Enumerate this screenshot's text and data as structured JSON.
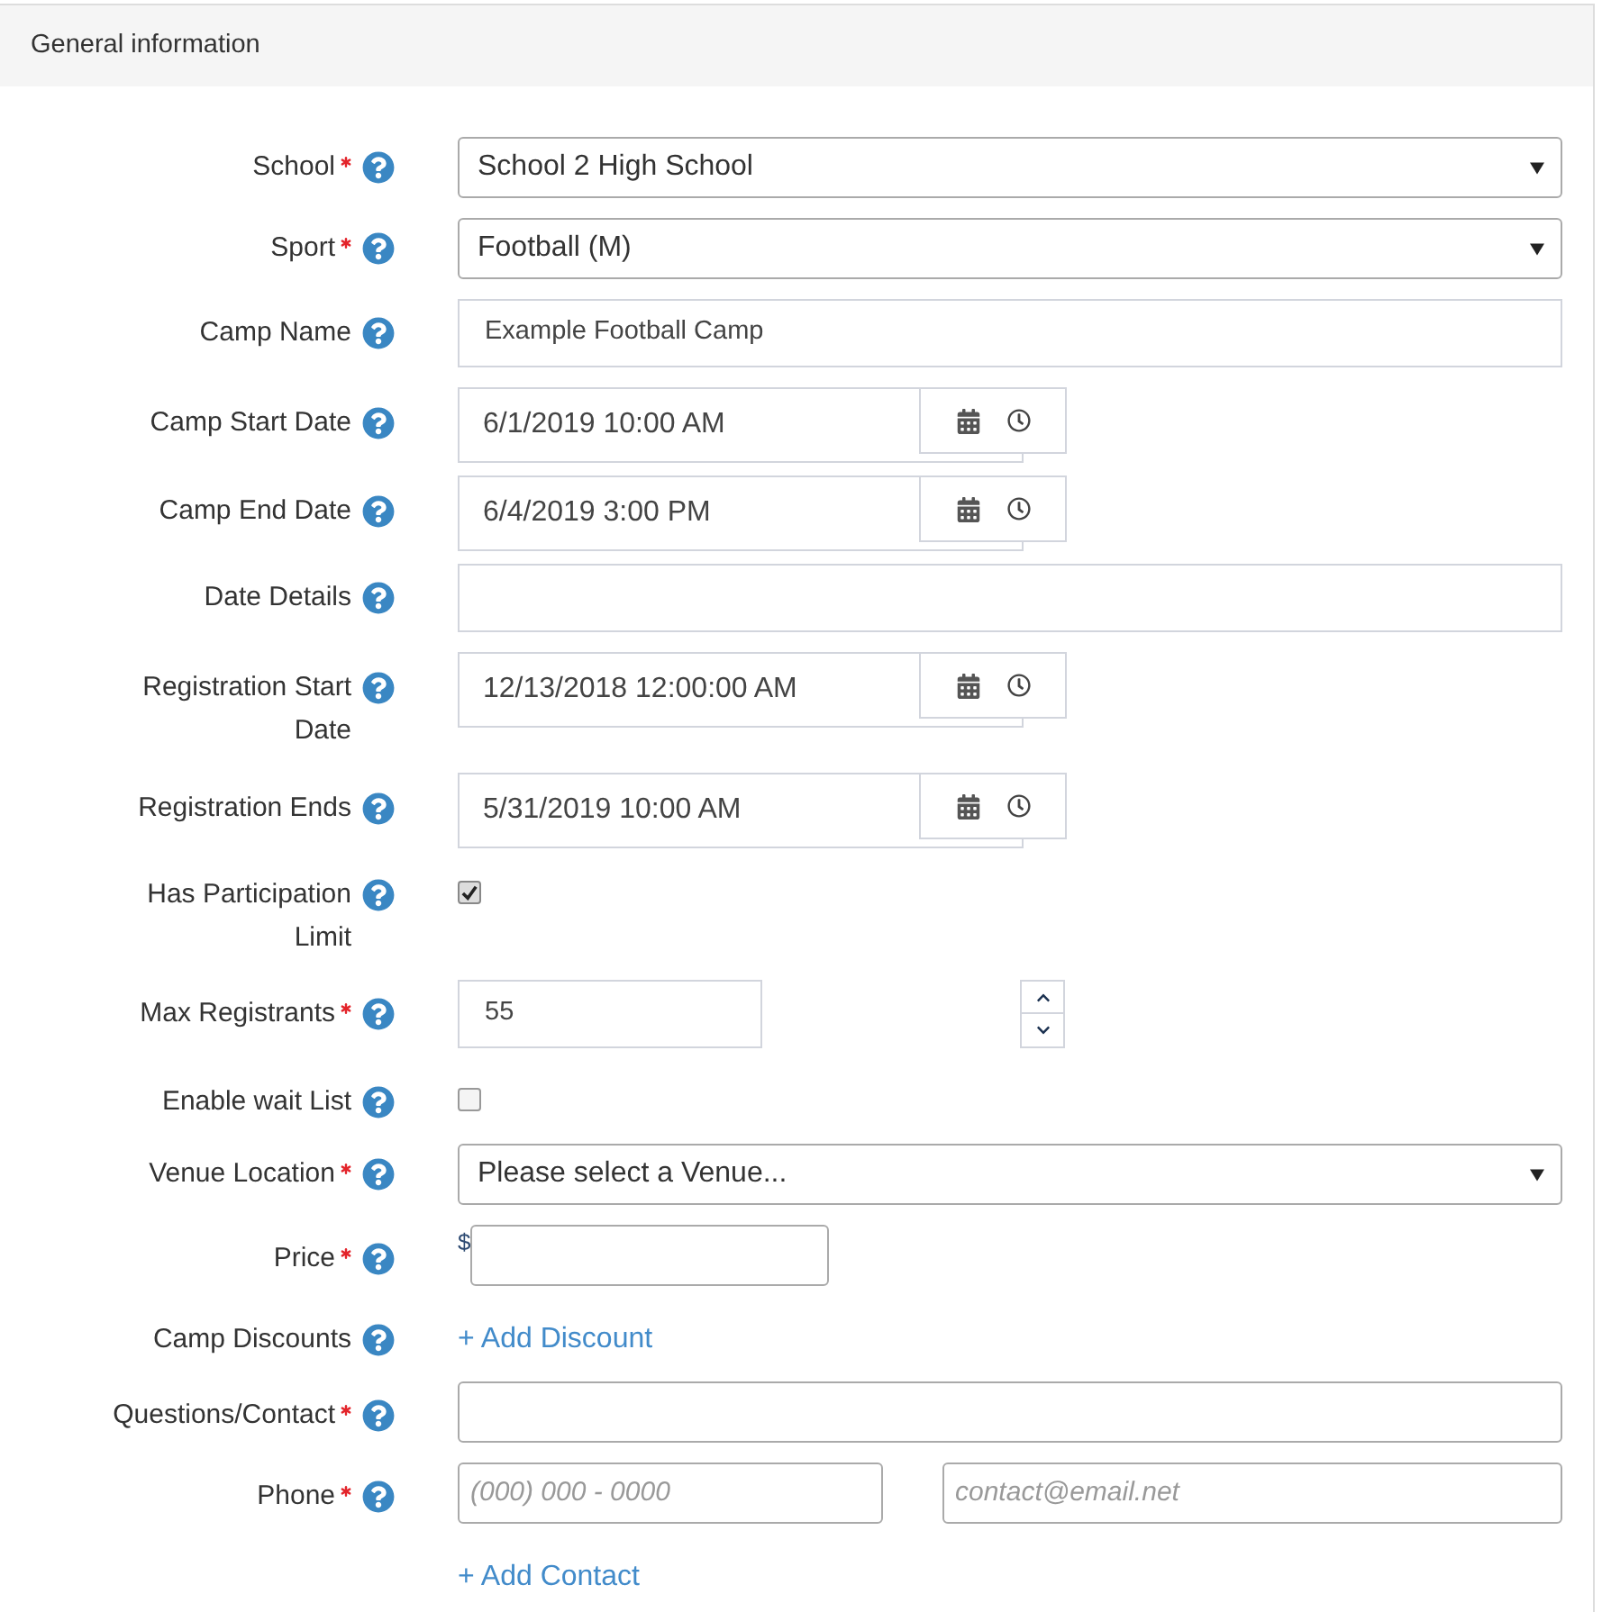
{
  "panel": {
    "title": "General information"
  },
  "fields": [
    {
      "kind": "select",
      "label": "School",
      "required": true,
      "value": "School 2 High School"
    },
    {
      "kind": "select",
      "label": "Sport",
      "required": true,
      "value": "Football (M)"
    },
    {
      "kind": "text",
      "label": "Camp Name",
      "required": false,
      "value": "Example Football Camp"
    },
    {
      "kind": "datetime",
      "label": "Camp Start Date",
      "required": false,
      "value": "6/1/2019 10:00 AM"
    },
    {
      "kind": "datetime",
      "label": "Camp End Date",
      "required": false,
      "value": "6/4/2019 3:00 PM"
    },
    {
      "kind": "text",
      "label": "Date Details",
      "required": false
    },
    {
      "kind": "datetime",
      "label": "Registration Start Date",
      "required": false,
      "value": "12/13/2018 12:00:00 AM"
    },
    {
      "kind": "datetime",
      "label": "Registration Ends",
      "required": false,
      "value": "5/31/2019 10:00 AM"
    },
    {
      "kind": "checkbox",
      "label": "Has Participation Limit",
      "required": false,
      "checked": true
    },
    {
      "kind": "number",
      "label": "Max Registrants",
      "required": true,
      "value": "55"
    },
    {
      "kind": "checkbox",
      "label": "Enable wait List",
      "required": false,
      "checked": false
    },
    {
      "kind": "select",
      "label": "Venue Location",
      "required": true,
      "value": "Please select a Venue..."
    },
    {
      "kind": "price",
      "label": "Price",
      "required": true,
      "currency": "$"
    },
    {
      "kind": "link",
      "label": "Camp Discounts",
      "required": false,
      "link": "+ Add Discount"
    },
    {
      "kind": "input",
      "label": "Questions/Contact",
      "required": true
    },
    {
      "kind": "contact",
      "label": "Phone",
      "required": true,
      "phone": {
        "placeholder": "(000) 000 - 0000"
      },
      "email": {
        "placeholder": "contact@email.net"
      }
    },
    {
      "kind": "link",
      "link": "+ Add Contact"
    }
  ]
}
